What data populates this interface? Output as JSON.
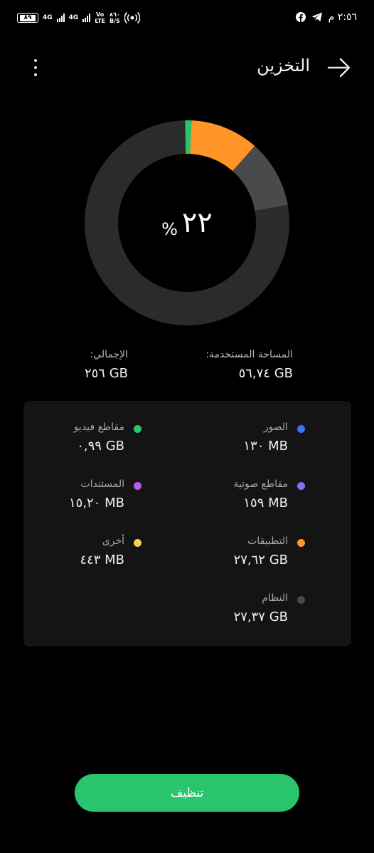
{
  "status_bar": {
    "battery": "٨٩",
    "network1": "4G",
    "network2": "4G",
    "volte_top": "Vo",
    "volte_bottom": "LTE",
    "speed_value": "٨٦٠",
    "speed_unit": "B/S",
    "time": "٢:٥٦ م",
    "icons": [
      "battery-icon",
      "signal-icon",
      "hotspot-icon",
      "facebook-icon",
      "telegram-icon"
    ]
  },
  "header": {
    "title": "التخزين"
  },
  "donut": {
    "percent_value": "٢٢",
    "percent_sign": "%",
    "segments": [
      {
        "name": "التطبيقات",
        "color": "#FF9527",
        "fraction": 0.108
      },
      {
        "name": "النظام",
        "color": "#4A4A4C",
        "fraction": 0.107
      },
      {
        "name": "free",
        "color": "#2B2B2B",
        "fraction": 0.775
      },
      {
        "name": "small",
        "color": "#2AC46D",
        "fraction": 0.01
      }
    ]
  },
  "summary": {
    "used_label": "المساحة المستخدمة:",
    "used_value": "٥٦,٧٤ GB",
    "total_label": "الإجمالي:",
    "total_value": "٢٥٦ GB"
  },
  "categories": [
    {
      "name": "الصور",
      "size": "١٣٠ MB",
      "color": "#3D72F5"
    },
    {
      "name": "مقاطع فيديو",
      "size": "٠,٩٩ GB",
      "color": "#2AC46D"
    },
    {
      "name": "مقاطع صوتية",
      "size": "١٥٩ MB",
      "color": "#8B6CF0"
    },
    {
      "name": "المستندات",
      "size": "١٥,٢٠ MB",
      "color": "#B85CE8"
    },
    {
      "name": "التطبيقات",
      "size": "٢٧,٦٢ GB",
      "color": "#FF9527"
    },
    {
      "name": "أخرى",
      "size": "٤٤٣ MB",
      "color": "#F5D052"
    },
    {
      "name": "النظام",
      "size": "٢٧,٣٧ GB",
      "color": "#4A4A4C"
    }
  ],
  "actions": {
    "clean_label": "تنظيف"
  }
}
